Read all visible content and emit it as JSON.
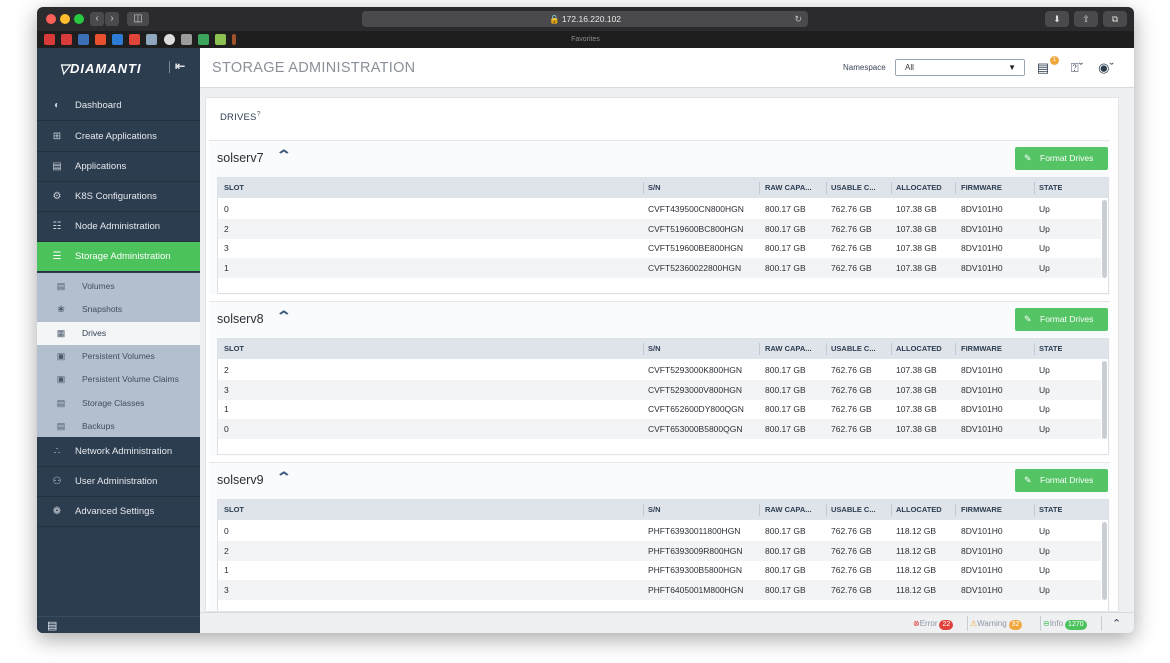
{
  "browser": {
    "url": "172.16.220.102",
    "favorites_label": "Favorites"
  },
  "app": {
    "brand": "DIAMANTI",
    "page_title": "STORAGE ADMINISTRATION",
    "namespace_label": "Namespace",
    "namespace_value": "All",
    "notifications_badge": "1"
  },
  "sidebar": {
    "items": [
      {
        "label": "Dashboard",
        "icon": "dashboard-icon"
      },
      {
        "label": "Create Applications",
        "icon": "plus-square-icon"
      },
      {
        "label": "Applications",
        "icon": "list-icon"
      },
      {
        "label": "K8S Configurations",
        "icon": "gear-icon"
      },
      {
        "label": "Node Administration",
        "icon": "node-icon"
      },
      {
        "label": "Storage Administration",
        "icon": "database-icon"
      },
      {
        "label": "Network Administration",
        "icon": "network-icon"
      },
      {
        "label": "User Administration",
        "icon": "users-icon"
      },
      {
        "label": "Advanced Settings",
        "icon": "settings-icon"
      }
    ],
    "sub_items": [
      {
        "label": "Volumes",
        "icon": "volume-icon"
      },
      {
        "label": "Snapshots",
        "icon": "camera-icon"
      },
      {
        "label": "Drives",
        "icon": "drive-icon"
      },
      {
        "label": "Persistent Volumes",
        "icon": "persistent-volume-icon"
      },
      {
        "label": "Persistent Volume Claims",
        "icon": "claim-icon"
      },
      {
        "label": "Storage Classes",
        "icon": "storage-class-icon"
      },
      {
        "label": "Backups",
        "icon": "backup-icon"
      }
    ]
  },
  "drives": {
    "title": "DRIVES",
    "info": "?",
    "format_label": "Format Drives",
    "columns": [
      "SLOT",
      "S/N",
      "RAW CAPA...",
      "USABLE C...",
      "ALLOCATED",
      "FIRMWARE",
      "STATE"
    ],
    "servers": [
      {
        "name": "solserv7",
        "rows": [
          [
            "0",
            "CVFT439500CN800HGN",
            "800.17 GB",
            "762.76 GB",
            "107.38 GB",
            "8DV101H0",
            "Up"
          ],
          [
            "2",
            "CVFT519600BC800HGN",
            "800.17 GB",
            "762.76 GB",
            "107.38 GB",
            "8DV101H0",
            "Up"
          ],
          [
            "3",
            "CVFT519600BE800HGN",
            "800.17 GB",
            "762.76 GB",
            "107.38 GB",
            "8DV101H0",
            "Up"
          ],
          [
            "1",
            "CVFT52360022800HGN",
            "800.17 GB",
            "762.76 GB",
            "107.38 GB",
            "8DV101H0",
            "Up"
          ]
        ]
      },
      {
        "name": "solserv8",
        "rows": [
          [
            "2",
            "CVFT5293000K800HGN",
            "800.17 GB",
            "762.76 GB",
            "107.38 GB",
            "8DV101H0",
            "Up"
          ],
          [
            "3",
            "CVFT5293000V800HGN",
            "800.17 GB",
            "762.76 GB",
            "107.38 GB",
            "8DV101H0",
            "Up"
          ],
          [
            "1",
            "CVFT652600DY800QGN",
            "800.17 GB",
            "762.76 GB",
            "107.38 GB",
            "8DV101H0",
            "Up"
          ],
          [
            "0",
            "CVFT653000B5800QGN",
            "800.17 GB",
            "762.76 GB",
            "107.38 GB",
            "8DV101H0",
            "Up"
          ]
        ]
      },
      {
        "name": "solserv9",
        "rows": [
          [
            "0",
            "PHFT63930011800HGN",
            "800.17 GB",
            "762.76 GB",
            "118.12 GB",
            "8DV101H0",
            "Up"
          ],
          [
            "2",
            "PHFT6393009R800HGN",
            "800.17 GB",
            "762.76 GB",
            "118.12 GB",
            "8DV101H0",
            "Up"
          ],
          [
            "1",
            "PHFT639300B5800HGN",
            "800.17 GB",
            "762.76 GB",
            "118.12 GB",
            "8DV101H0",
            "Up"
          ],
          [
            "3",
            "PHFT6405001M800HGN",
            "800.17 GB",
            "762.76 GB",
            "118.12 GB",
            "8DV101H0",
            "Up"
          ]
        ]
      }
    ]
  },
  "status": {
    "error_label": "Error",
    "error_count": "22",
    "warning_label": "Warning",
    "warning_count": "32",
    "info_label": "Info",
    "info_count": "1270"
  },
  "colors": {
    "accent_green": "#4cc25c",
    "sidebar": "#2d3d50",
    "submenu": "#b3bfce",
    "error": "#e0423b",
    "warning": "#f1a63b",
    "info": "#4cc25c"
  }
}
